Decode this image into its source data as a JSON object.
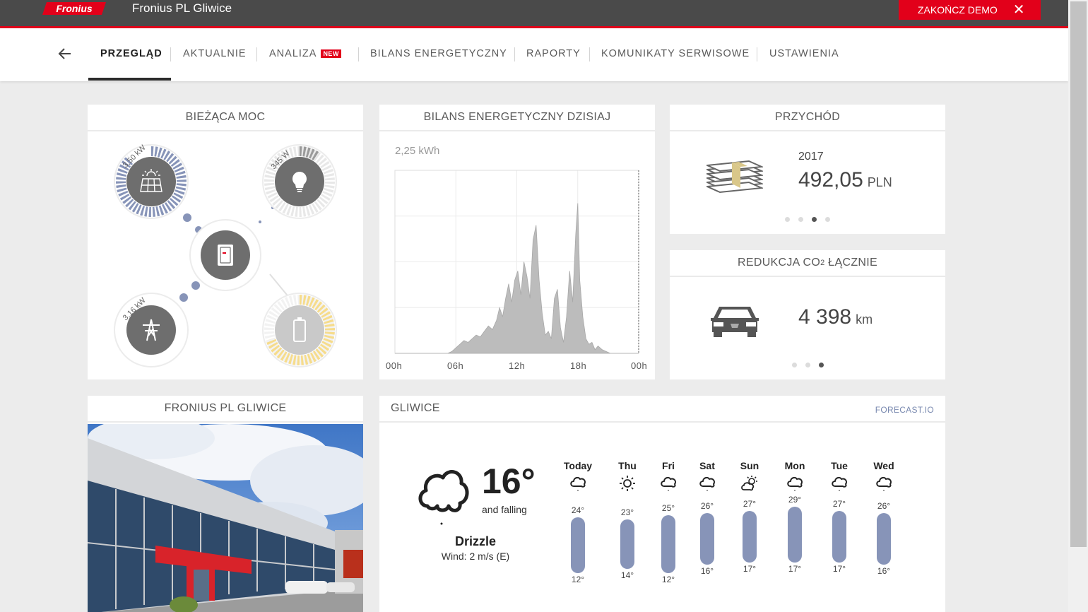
{
  "header": {
    "logo_text": "Fronius",
    "site_title": "Fronius PL Gliwice",
    "end_demo_label": "ZAKOŃCZ DEMO",
    "brand_color": "#e2001a"
  },
  "nav": {
    "tabs": [
      {
        "label": "PRZEGLĄD",
        "active": true
      },
      {
        "label": "AKTUALNIE"
      },
      {
        "label": "ANALIZA",
        "badge": "NEW"
      },
      {
        "label": "BILANS ENERGETYCZNY"
      },
      {
        "label": "RAPORTY"
      },
      {
        "label": "KOMUNIKATY SERWISOWE"
      },
      {
        "label": "USTAWIENIA"
      }
    ]
  },
  "current_power": {
    "title": "BIEŻĄCA MOC",
    "pv": {
      "value": "3,50 kW",
      "icon": "solar-panel-icon",
      "ring_fill": 0.88,
      "ring_color": "#8794b8"
    },
    "load": {
      "value": "345 W",
      "icon": "lightbulb-icon",
      "ring_fill": 0.1,
      "ring_color": "#9a9a9a"
    },
    "grid": {
      "value": "3,16 kW",
      "icon": "power-pylon-icon"
    },
    "battery": {
      "icon": "battery-icon",
      "ring_fill": 0.7,
      "ring_color": "#f6dc8c"
    },
    "inverter": {
      "icon": "inverter-icon"
    }
  },
  "energy_balance": {
    "title": "BILANS ENERGETYCZNY DZISIAJ",
    "total_label": "2,25 kWh",
    "chart_data": {
      "type": "area",
      "xlabel": "",
      "ylabel": "",
      "x_ticks": [
        "00h",
        "06h",
        "12h",
        "18h",
        "00h"
      ],
      "xlim": [
        0,
        24
      ],
      "x": [
        0,
        5.2,
        5.6,
        6.0,
        6.4,
        6.8,
        7.2,
        7.6,
        8.0,
        8.4,
        8.8,
        9.2,
        9.6,
        10.0,
        10.3,
        10.6,
        10.9,
        11.2,
        11.5,
        11.8,
        12.1,
        12.4,
        12.7,
        13.0,
        13.3,
        13.6,
        13.9,
        14.2,
        14.5,
        14.8,
        15.1,
        15.4,
        15.7,
        16.0,
        16.3,
        16.6,
        16.9,
        17.2,
        17.5,
        17.8,
        18.0,
        18.2,
        18.5,
        18.8,
        19.1,
        19.4,
        19.7,
        20.0,
        20.4,
        20.8,
        21.2,
        24
      ],
      "values": [
        0,
        0,
        0.01,
        0.03,
        0.05,
        0.07,
        0.06,
        0.08,
        0.1,
        0.09,
        0.12,
        0.15,
        0.13,
        0.18,
        0.25,
        0.2,
        0.3,
        0.38,
        0.28,
        0.4,
        0.45,
        0.32,
        0.5,
        0.42,
        0.3,
        0.62,
        0.7,
        0.4,
        0.22,
        0.1,
        0.12,
        0.08,
        0.3,
        0.35,
        0.14,
        0.06,
        0.2,
        0.45,
        0.28,
        0.65,
        0.82,
        0.4,
        0.2,
        0.08,
        0.05,
        0.06,
        0.02,
        0.04,
        0.02,
        0.01,
        0,
        0
      ],
      "ylim": [
        0,
        1
      ],
      "fill_color": "#bcbcbc",
      "grid": true
    }
  },
  "revenue": {
    "title": "PRZYCHÓD",
    "icon": "money-stack-icon",
    "year": "2017",
    "value": "492,05",
    "unit": "PLN",
    "active_page": 3,
    "page_count": 4
  },
  "co2": {
    "title_prefix": "REDUKCJA CO",
    "title_sub": "2",
    "title_suffix": " ŁĄCZNIE",
    "icon": "car-icon",
    "value": "4 398",
    "unit": "km",
    "active_page": 3,
    "page_count": 3
  },
  "site_photo": {
    "title": "FRONIUS PL GLIWICE"
  },
  "weather": {
    "location": "GLIWICE",
    "source": "FORECAST.IO",
    "current": {
      "icon": "cloud-icon",
      "temperature": "16°",
      "trend": "and falling",
      "summary": "Drizzle",
      "wind": "Wind: 2 m/s (E)"
    },
    "days": [
      {
        "name": "Today",
        "icon": "cloud-icon",
        "max": "24°",
        "min": "12°"
      },
      {
        "name": "Thu",
        "icon": "sun-icon",
        "max": "23°",
        "min": "14°"
      },
      {
        "name": "Fri",
        "icon": "cloud-icon",
        "max": "25°",
        "min": "12°"
      },
      {
        "name": "Sat",
        "icon": "cloud-icon",
        "max": "26°",
        "min": "16°"
      },
      {
        "name": "Sun",
        "icon": "partly-cloudy-icon",
        "max": "27°",
        "min": "17°"
      },
      {
        "name": "Mon",
        "icon": "cloud-icon",
        "max": "29°",
        "min": "17°"
      },
      {
        "name": "Tue",
        "icon": "cloud-icon",
        "max": "27°",
        "min": "17°"
      },
      {
        "name": "Wed",
        "icon": "cloud-icon",
        "max": "26°",
        "min": "16°"
      }
    ],
    "bar_color": "#8794b8"
  }
}
